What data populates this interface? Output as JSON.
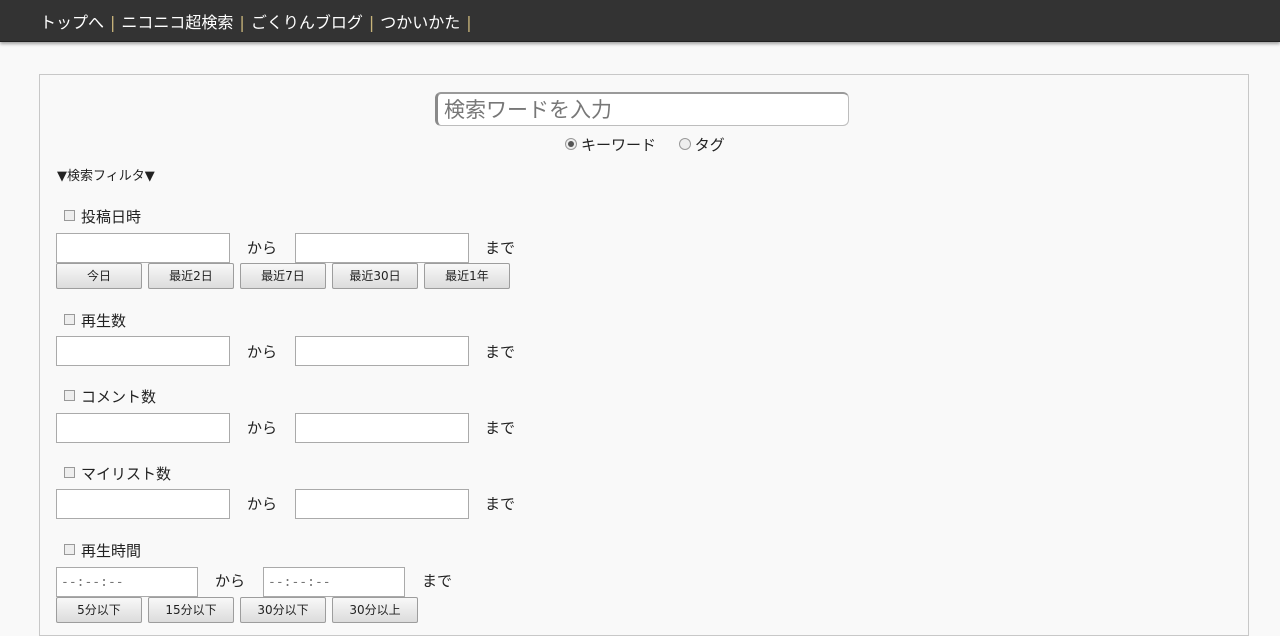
{
  "nav": {
    "items": [
      "トップへ",
      "ニコニコ超検索",
      "ごくりんブログ",
      "つかいかた"
    ],
    "separator": "|"
  },
  "search": {
    "placeholder": "検索ワードを入力",
    "modes": [
      {
        "label": "キーワード",
        "checked": true
      },
      {
        "label": "タグ",
        "checked": false
      }
    ]
  },
  "filter": {
    "toggle_label": "▼検索フィルタ▼",
    "from_label": "から",
    "to_label": "まで",
    "sections": [
      {
        "title": "投稿日時",
        "buttons": [
          "今日",
          "最近2日",
          "最近7日",
          "最近30日",
          "最近1年"
        ]
      },
      {
        "title": "再生数"
      },
      {
        "title": "コメント数"
      },
      {
        "title": "マイリスト数"
      },
      {
        "title": "再生時間",
        "time_placeholder": "--:--:--",
        "buttons": [
          "5分以下",
          "15分以下",
          "30分以下",
          "30分以上"
        ]
      }
    ]
  }
}
